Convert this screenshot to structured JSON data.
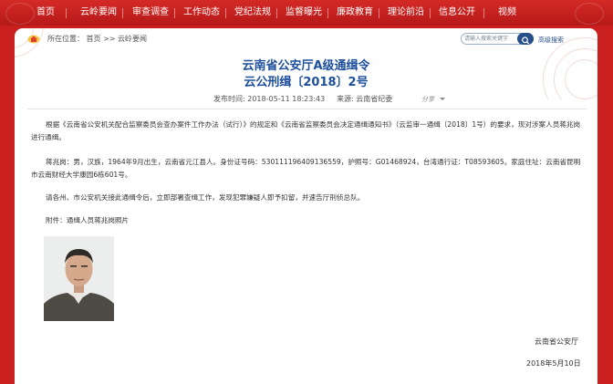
{
  "nav": {
    "items": [
      {
        "label": "首页"
      },
      {
        "label": "云岭要闻"
      },
      {
        "label": "审查调查"
      },
      {
        "label": "工作动态"
      },
      {
        "label": "党纪法规"
      },
      {
        "label": "监督曝光"
      },
      {
        "label": "廉政教育"
      },
      {
        "label": "理论前沿"
      },
      {
        "label": "信息公开"
      },
      {
        "label": "视频"
      }
    ]
  },
  "breadcrumb": {
    "prefix": "所在位置：",
    "home": "首页",
    "sep": ">>",
    "current": "云岭要闻"
  },
  "search": {
    "placeholder": "请输入搜索关键字",
    "advanced": "高级搜索"
  },
  "article": {
    "title_line1": "云南省公安厅A级通缉令",
    "title_line2": "云公刑缉〔2018〕2号",
    "publish_time": "发布时间: 2018-05-11 18:23:43",
    "source": "来源: 云南省纪委",
    "share": "分享",
    "paragraphs": [
      "根据《云南省公安机关配合监察委员会查办案件工作办法（试行）》的规定和《云南省监察委员会决定通缉通知书》（云监审一通缉〔2018〕1号）的要求，现对涉案人员蒋兆岗进行通缉。",
      "蒋兆岗：男，汉族，1964年9月出生，云南省元江县人。身份证号码：530111196409136559，护照号：G01468924，台湾通行证：T08593605。家庭住址：云南省昆明市云南财经大学康园6栋601号。",
      "请各州、市公安机关接此通缉令后，立即部署查缉工作，发现犯罪嫌疑人即予扣留，并速告厅刑侦总队。",
      "附件：通缉人员蒋兆岗照片"
    ],
    "signature": "云南省公安厅",
    "sign_date": "2018年5月10日"
  },
  "colors": {
    "brand_red": "#c9201f",
    "title_blue": "#1e4f9c",
    "search_button": "#27508a"
  },
  "icons": {
    "home": "home-icon",
    "search": "search-icon",
    "share_dropdown": "chevron-down-icon"
  }
}
